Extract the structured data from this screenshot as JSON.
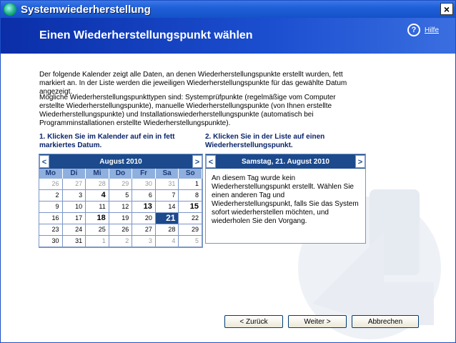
{
  "window": {
    "title": "Systemwiederherstellung",
    "close_label": "×"
  },
  "header": {
    "title": "Einen Wiederherstellungspunkt wählen",
    "help_label": "Hilfe",
    "help_icon": "?"
  },
  "intro": {
    "p1": "Der folgende Kalender zeigt alle Daten, an denen Wiederherstellungspunkte erstellt wurden, fett markiert an. In der Liste werden die jeweiligen Wiederherstellungspunkte für das gewählte Datum angezeigt.",
    "p2": "Mögliche Wiederherstellungspunkttypen sind: Systemprüfpunkte (regelmäßige vom Computer erstellte Wiederherstellungspunkte), manuelle Wiederherstellungspunkte (von Ihnen erstellte Wiederherstellungspunkte) und Installationswiederherstellungspunkte (automatisch bei Programminstallationen erstellte Wiederherstellungspunkte)."
  },
  "steps": {
    "step1": "1. Klicken Sie im Kalender auf ein in fett markiertes Datum.",
    "step2": "2. Klicken Sie in der Liste auf einen Wiederherstellungspunkt."
  },
  "calendar": {
    "month": "August 2010",
    "prev": "<",
    "next": ">",
    "weekdays": [
      "Mo",
      "Di",
      "Mi",
      "Do",
      "Fr",
      "Sa",
      "So"
    ],
    "rows": [
      [
        {
          "d": "26",
          "t": "other"
        },
        {
          "d": "27",
          "t": "other"
        },
        {
          "d": "28",
          "t": "other"
        },
        {
          "d": "29",
          "t": "other"
        },
        {
          "d": "30",
          "t": "other"
        },
        {
          "d": "31",
          "t": "other"
        },
        {
          "d": "1",
          "t": ""
        }
      ],
      [
        {
          "d": "2",
          "t": ""
        },
        {
          "d": "3",
          "t": ""
        },
        {
          "d": "4",
          "t": "bold"
        },
        {
          "d": "5",
          "t": ""
        },
        {
          "d": "6",
          "t": ""
        },
        {
          "d": "7",
          "t": ""
        },
        {
          "d": "8",
          "t": ""
        }
      ],
      [
        {
          "d": "9",
          "t": ""
        },
        {
          "d": "10",
          "t": ""
        },
        {
          "d": "11",
          "t": ""
        },
        {
          "d": "12",
          "t": ""
        },
        {
          "d": "13",
          "t": "bold"
        },
        {
          "d": "14",
          "t": ""
        },
        {
          "d": "15",
          "t": "bold"
        }
      ],
      [
        {
          "d": "16",
          "t": ""
        },
        {
          "d": "17",
          "t": ""
        },
        {
          "d": "18",
          "t": "bold"
        },
        {
          "d": "19",
          "t": ""
        },
        {
          "d": "20",
          "t": ""
        },
        {
          "d": "21",
          "t": "sel"
        },
        {
          "d": "22",
          "t": ""
        }
      ],
      [
        {
          "d": "23",
          "t": ""
        },
        {
          "d": "24",
          "t": ""
        },
        {
          "d": "25",
          "t": ""
        },
        {
          "d": "26",
          "t": ""
        },
        {
          "d": "27",
          "t": ""
        },
        {
          "d": "28",
          "t": ""
        },
        {
          "d": "29",
          "t": ""
        }
      ],
      [
        {
          "d": "30",
          "t": ""
        },
        {
          "d": "31",
          "t": ""
        },
        {
          "d": "1",
          "t": "other"
        },
        {
          "d": "2",
          "t": "other"
        },
        {
          "d": "3",
          "t": "other"
        },
        {
          "d": "4",
          "t": "other"
        },
        {
          "d": "5",
          "t": "other"
        }
      ]
    ]
  },
  "list": {
    "prev": "<",
    "next": ">",
    "date": "Samstag, 21. August 2010",
    "message": "An diesem Tag wurde kein Wiederherstellungspunkt erstellt. Wählen Sie einen anderen Tag und Wiederherstellungspunkt, falls Sie das System sofort wiederherstellen möchten, und wiederholen Sie den Vorgang."
  },
  "buttons": {
    "back": "< Zurück",
    "next": "Weiter >",
    "cancel": "Abbrechen"
  }
}
